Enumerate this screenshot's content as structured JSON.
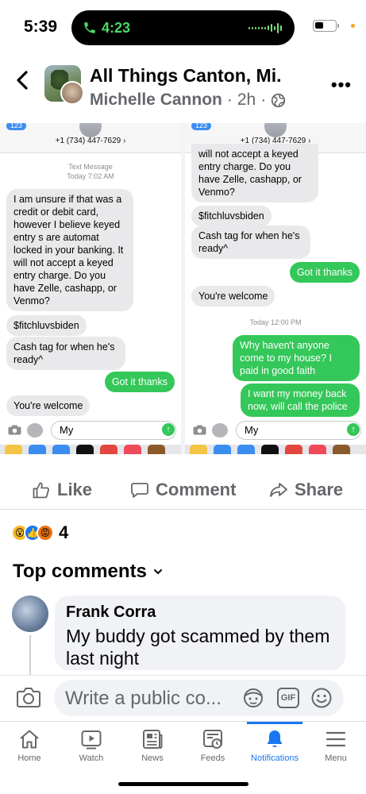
{
  "status_bar": {
    "time": "5:39",
    "call_time": "4:23"
  },
  "post": {
    "group_name": "All Things Canton, Mi.",
    "author": "Michelle Cannon",
    "separator": "·",
    "time_ago": "2h",
    "more": "•••"
  },
  "screenshot": {
    "left": {
      "back_badge": "123",
      "contact_number": "+1 (734) 447-7629 ›",
      "stamp_line1": "Text Message",
      "stamp_line2": "Today 7:02 AM",
      "messages": [
        {
          "dir": "in",
          "text": "I am unsure if that was a credit or debit card, however I believe keyed entry s are automat locked in your banking. It will not accept a keyed entry charge. Do you have Zelle, cashapp, or Venmo?"
        },
        {
          "dir": "in",
          "text": "$fitchluvsbiden"
        },
        {
          "dir": "in",
          "text": "Cash tag for when he's ready^"
        },
        {
          "dir": "out",
          "text": "Got it thanks"
        },
        {
          "dir": "in",
          "text": "You're welcome"
        }
      ],
      "compose_text": "My"
    },
    "right": {
      "back_badge": "123",
      "contact_number": "+1 (734) 447-7629 ›",
      "stamp": "Today 12:00 PM",
      "messages": [
        {
          "dir": "in",
          "text": "will not accept a keyed entry charge. Do you have Zelle, cashapp, or Venmo?"
        },
        {
          "dir": "in",
          "text": "$fitchluvsbiden"
        },
        {
          "dir": "in",
          "text": "Cash tag for when he's ready^"
        },
        {
          "dir": "out",
          "text": "Got it thanks"
        },
        {
          "dir": "in",
          "text": "You're welcome"
        },
        {
          "dir": "out",
          "text": "Why haven't anyone come to my house? I paid in good faith"
        },
        {
          "dir": "out",
          "text": "I want my money back now, will call the police"
        }
      ],
      "compose_text": "My"
    }
  },
  "actions": {
    "like": "Like",
    "comment": "Comment",
    "share": "Share"
  },
  "reactions": {
    "types": [
      "wow",
      "like",
      "angry"
    ],
    "count": "4"
  },
  "comments": {
    "header": "Top comments",
    "items": [
      {
        "author": "Frank Corra",
        "text": "My buddy got scammed by them last night"
      }
    ]
  },
  "composer": {
    "placeholder": "Write a public co...",
    "gif_label": "GIF"
  },
  "tabs": [
    {
      "label": "Home",
      "icon": "home-icon"
    },
    {
      "label": "Watch",
      "icon": "watch-icon"
    },
    {
      "label": "News",
      "icon": "news-icon"
    },
    {
      "label": "Feeds",
      "icon": "feeds-icon"
    },
    {
      "label": "Notifications",
      "icon": "bell-icon",
      "active": true
    },
    {
      "label": "Menu",
      "icon": "menu-icon"
    }
  ],
  "colors": {
    "facebook_blue": "#1877f2",
    "imessage_green": "#34c759",
    "secondary_text": "#65676b"
  }
}
